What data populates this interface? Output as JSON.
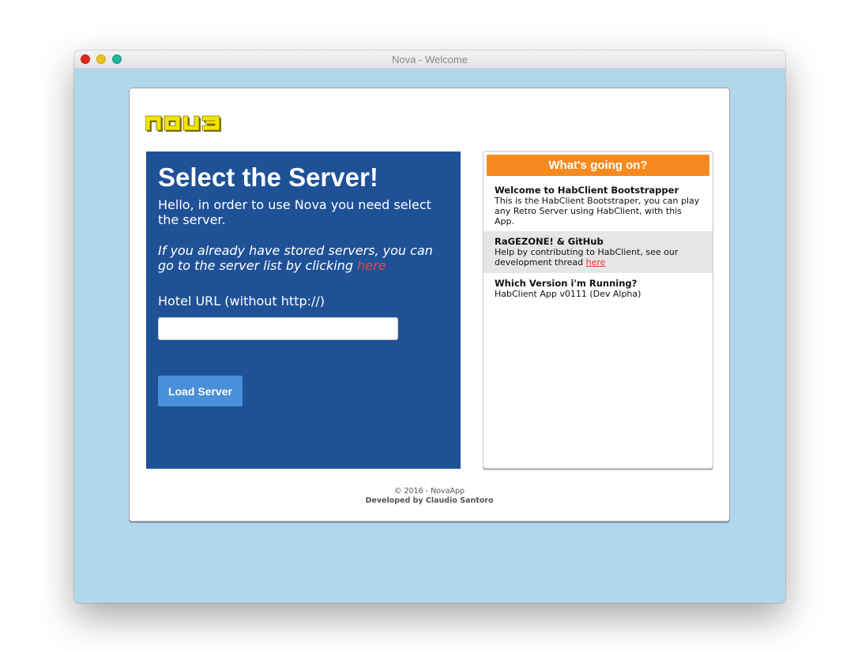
{
  "window": {
    "title": "Nova - Welcome"
  },
  "brand": {
    "logo_text": "NOVA",
    "logo_colors": {
      "fill": "#f2e600",
      "edge": "#8a7d00"
    }
  },
  "server_panel": {
    "heading": "Select the Server!",
    "intro": "Hello, in order to use Nova you need select the server.",
    "stored_prefix": "If you already have stored servers, you can go to the server list by clicking ",
    "stored_link": "here",
    "hotel_label": "Hotel URL (without http://)",
    "url_value": "",
    "url_placeholder": "",
    "load_button": "Load Server"
  },
  "news": {
    "header": "What's going on?",
    "items": [
      {
        "title": "Welcome to HabClient Bootstrapper",
        "body": "This is the HabClient Bootstraper, you can play any Retro Server using HabClient, with this App."
      },
      {
        "title": "RaGEZONE! & GitHub",
        "body": "Help by contributing to HabClient, see our development thread ",
        "link": "here"
      },
      {
        "title": "Which Version i'm Running?",
        "body": "HabClient App v0111 (Dev Alpha)"
      }
    ]
  },
  "footer": {
    "copyright": "© 2016 - NovaApp",
    "developer": "Developed by Claudio Santoro"
  },
  "colors": {
    "background": "#b0d8ea",
    "panel_blue": "#1f5197",
    "button_blue": "#4a8fd9",
    "orange": "#f58a1f",
    "link_red": "#e84545"
  }
}
